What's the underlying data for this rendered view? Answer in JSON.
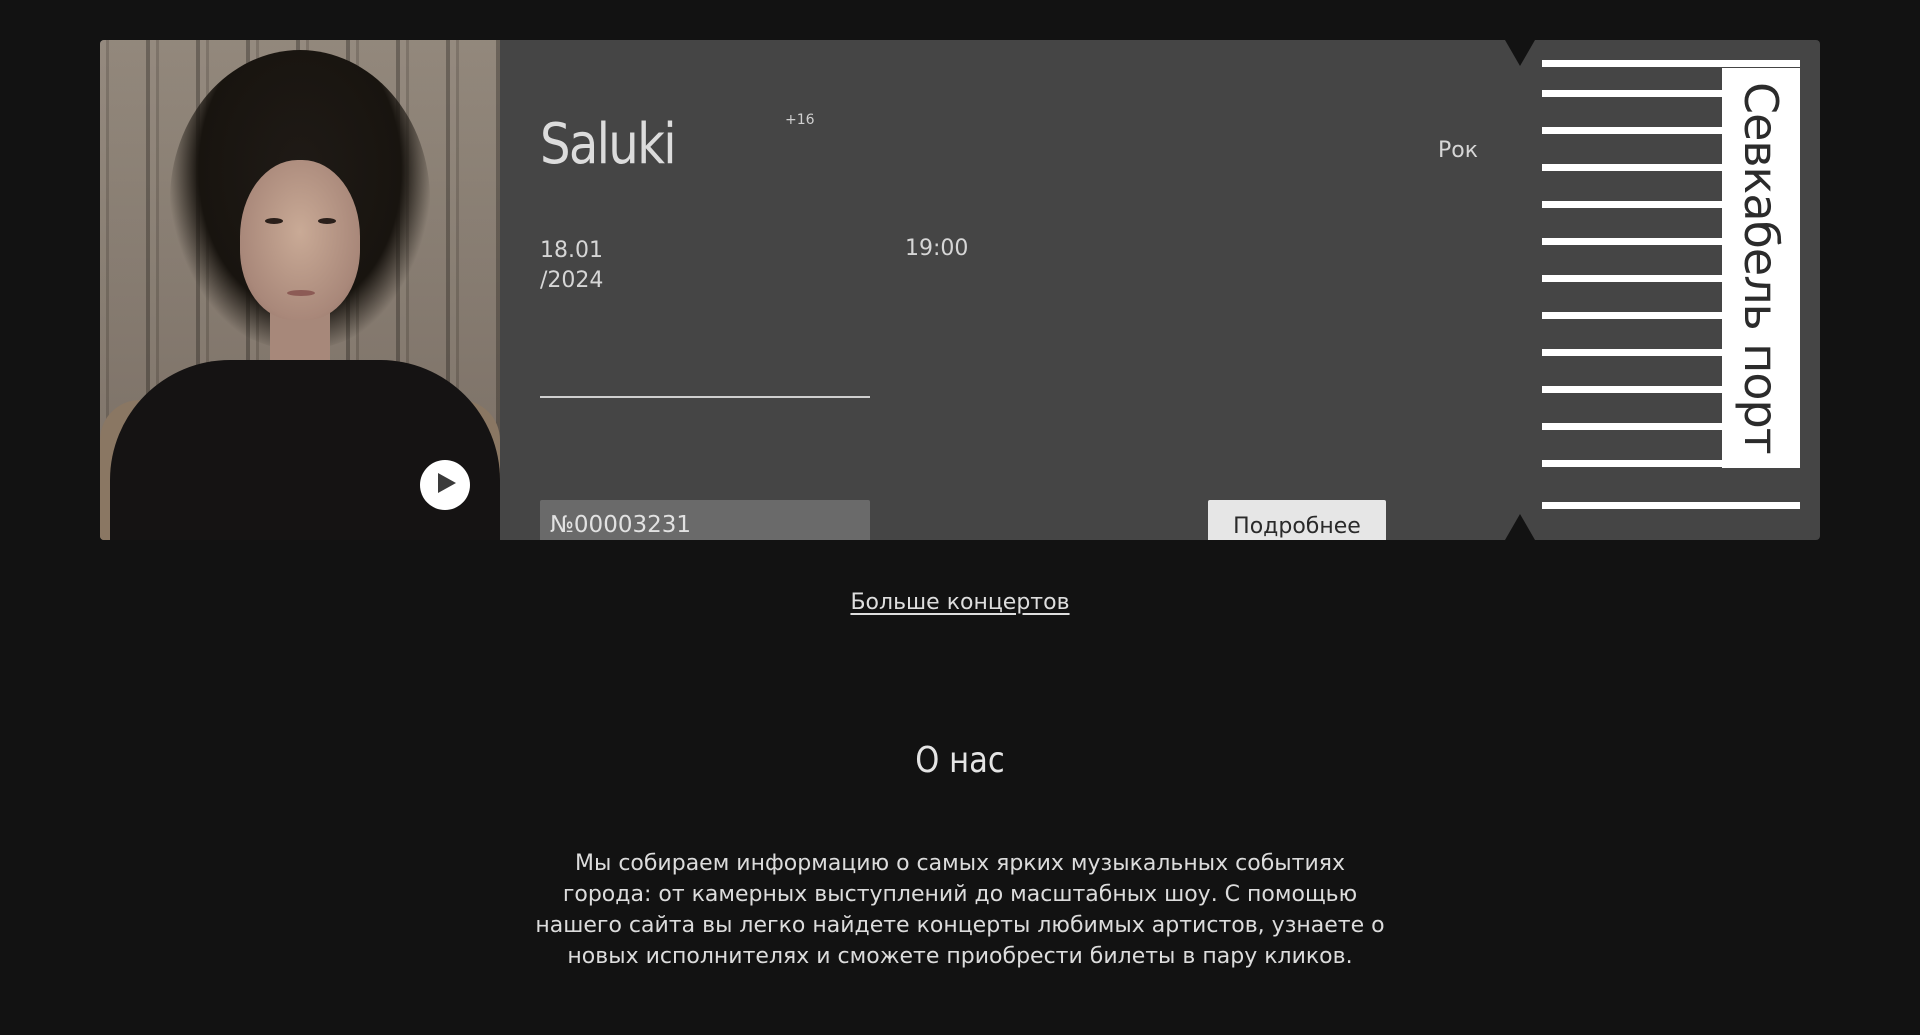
{
  "concert": {
    "artist": "Saluki",
    "age_rating": "+16",
    "genre": "Рок",
    "date_line1": "18.01",
    "date_line2": "/2024",
    "time": "19:00",
    "ticket_number": "№00003231",
    "details_button": "Подробнее",
    "venue": "Севкабель порт"
  },
  "more_concerts_link": "Больше концертов",
  "about": {
    "title": "О нас",
    "text": "Мы собираем информацию о самых ярких музыкальных событиях города: от камерных выступлений до масштабных шоу. С помощью нашего сайта вы легко найдете концерты любимых артистов, узнаете о новых исполнителях и сможете приобрести билеты в пару кликов."
  },
  "icons": {
    "play": "play-icon"
  }
}
